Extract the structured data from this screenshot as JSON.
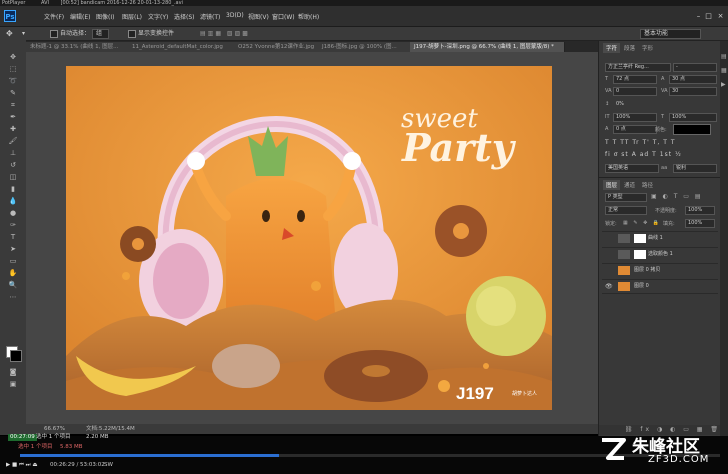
{
  "player": {
    "title": "PotPlayer",
    "codec": "AVI",
    "file": "[00:52] bandicam 2016-12-26 20-01-13-280_.avi"
  },
  "app": {
    "logo": "Ps"
  },
  "menu": [
    "文件(F)",
    "编辑(E)",
    "图像(I)",
    "图层(L)",
    "文字(Y)",
    "选择(S)",
    "滤镜(T)",
    "3D(D)",
    "视图(V)",
    "窗口(W)",
    "帮助(H)"
  ],
  "window_buttons": [
    "–",
    "□",
    "×"
  ],
  "options": {
    "auto_select_label": "自动选择：",
    "auto_select_value": "组",
    "transform_label": "显示变换控件"
  },
  "workspace": "基本功能",
  "tabs": [
    {
      "label": "未标题-1 @ 33.1% (曲线 1, 图层...",
      "active": false
    },
    {
      "label": "11_Asteroid_defaultMat_color.jpg",
      "active": false
    },
    {
      "label": "O252 Yvonne第12课作业.jpg",
      "active": false
    },
    {
      "label": "J186-图标.jpg @ 100% (图...",
      "active": false
    },
    {
      "label": "J197-胡萝卜-深圳.png @ 66.7% (曲线 1, 图层蒙版/8) *",
      "active": true
    }
  ],
  "artwork": {
    "title_line1": "sweet",
    "title_line2": "Party",
    "badge": "J197",
    "subtext": "胡萝卜达人"
  },
  "status": {
    "zoom": "66.67%",
    "doc": "文档:5.22M/15.4M"
  },
  "panels": {
    "char_tabs": [
      "字符",
      "段落",
      "字形"
    ],
    "font_family": "方正兰亭纤 Reg...",
    "font_style": "-",
    "font_size": "72 点",
    "leading": "30 点",
    "tracking": "0",
    "kerning": "30",
    "vscale": "100%",
    "hscale": "100%",
    "baseline": "0 点",
    "color_label": "颜色:",
    "style_buttons": [
      "T",
      "T",
      "TT",
      "Tr",
      "T'",
      "T,",
      "T",
      "T"
    ],
    "ligature_buttons": [
      "fi",
      "ơ",
      "st",
      "A",
      "ad",
      "T",
      "1st",
      "½"
    ],
    "language": "美国英语",
    "aa_label": "aa",
    "aa_value": "锐利",
    "layers_tabs": [
      "图层",
      "通道",
      "路径"
    ],
    "layer_filter": "P 类型",
    "blend_mode": "正常",
    "opacity_label": "不透明度:",
    "opacity": "100%",
    "lock_label": "锁定:",
    "fill_label": "填充:",
    "fill": "100%",
    "layers": [
      {
        "name": "曲线 1",
        "visible": false
      },
      {
        "name": "选取颜色 1",
        "visible": false
      },
      {
        "name": "图层 0 拷贝",
        "visible": false
      },
      {
        "name": "图层 0",
        "visible": true
      }
    ]
  },
  "taskbar": {
    "rec_time": "00:27:09",
    "rec_label": "选中 1 个项目",
    "rec_size": "2.20 MB",
    "row2_label": "选中 1 个项目",
    "row2_size": "5.83 MB",
    "playback": "00:26:29 / 53:03:02",
    "playback_mode": "SW",
    "progress": 0.37
  },
  "watermark": {
    "line1": "朱峰社区",
    "line2": "ZF3D.COM"
  }
}
